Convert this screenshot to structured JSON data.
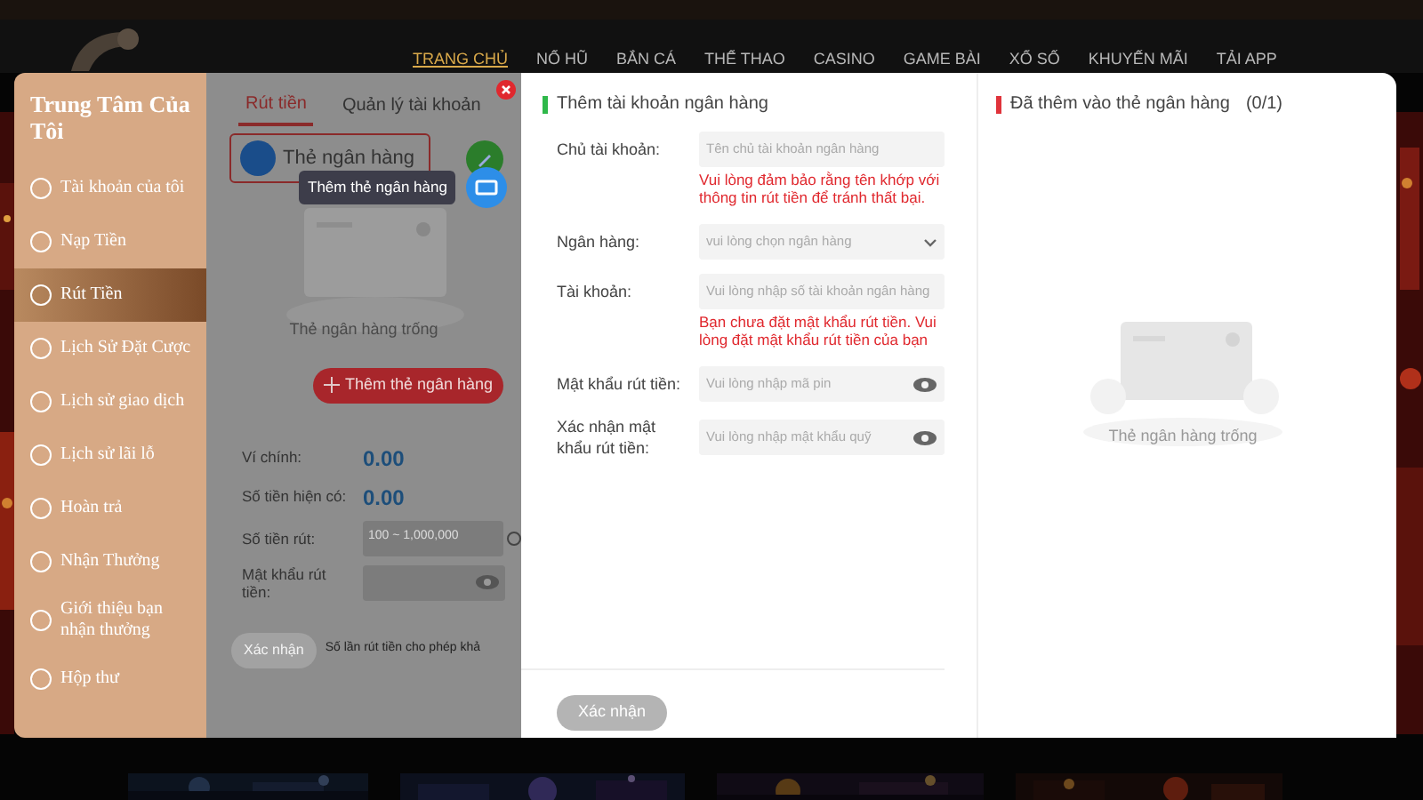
{
  "nav": {
    "items": [
      {
        "label": "TRANG CHỦ",
        "selected": true
      },
      {
        "label": "NỔ HŨ",
        "selected": false
      },
      {
        "label": "BẮN CÁ",
        "selected": false
      },
      {
        "label": "THỂ THAO",
        "selected": false
      },
      {
        "label": "CASINO",
        "selected": false
      },
      {
        "label": "GAME BÀI",
        "selected": false
      },
      {
        "label": "XỔ SỐ",
        "selected": false
      },
      {
        "label": "KHUYẾN MÃI",
        "selected": false
      },
      {
        "label": "TẢI APP",
        "selected": false
      }
    ]
  },
  "sidebar": {
    "title": "Trung Tâm Của Tôi",
    "items": [
      {
        "label": "Tài khoản của tôi",
        "selected": false
      },
      {
        "label": "Nạp Tiền",
        "selected": false
      },
      {
        "label": "Rút Tiền",
        "selected": true
      },
      {
        "label": "Lịch Sử Đặt Cược",
        "selected": false
      },
      {
        "label": "Lịch sử giao dịch",
        "selected": false
      },
      {
        "label": "Lịch sử lãi lỗ",
        "selected": false
      },
      {
        "label": "Hoàn trả",
        "selected": false
      },
      {
        "label": "Nhận Thưởng",
        "selected": false
      },
      {
        "label": "Giới thiệu bạn nhận thưởng",
        "selected": false
      },
      {
        "label": "Hộp thư",
        "selected": false
      }
    ]
  },
  "withdraw": {
    "tabs": [
      {
        "label": "Rút tiền",
        "selected": true
      },
      {
        "label": "Quản lý tài khoản",
        "selected": false
      }
    ],
    "bank_card_button": "Thẻ ngân hàng",
    "tooltip": "Thêm thẻ ngân hàng",
    "empty_text": "Thẻ ngân hàng trống",
    "add_button": "Thêm thẻ ngân hàng",
    "balances": [
      {
        "label": "Ví chính:",
        "value": "0.00"
      },
      {
        "label": "Số tiền hiện có:",
        "value": "0.00"
      }
    ],
    "fields": [
      {
        "kind": "amount",
        "label": "Số tiền rút:",
        "placeholder": "100 ~ 1,000,000"
      },
      {
        "kind": "password",
        "label": "Mật khẩu rút tiền:"
      }
    ],
    "confirm_button": "Xác nhận",
    "note": "Số lần rút tiền cho phép khả"
  },
  "add_account": {
    "title": "Thêm tài khoản ngân hàng",
    "rows": [
      {
        "kind": "text",
        "label": "Chủ tài khoản:",
        "placeholder": "Tên chủ tài khoản ngân hàng"
      },
      {
        "kind": "warning",
        "text": "Vui lòng đảm bảo rằng tên khớp với thông tin rút tiền để tránh thất bại."
      },
      {
        "kind": "select",
        "label": "Ngân hàng:",
        "placeholder": "vui lòng chọn ngân hàng"
      },
      {
        "kind": "text",
        "label": "Tài khoản:",
        "placeholder": "Vui lòng nhập số tài khoản ngân hàng"
      },
      {
        "kind": "warning",
        "text": "Bạn chưa đặt mật khẩu rút tiền. Vui lòng đặt mật khẩu rút tiền của bạn"
      },
      {
        "kind": "password",
        "label": "Mật khẩu rút tiền:",
        "placeholder": "Vui lòng nhập mã pin"
      },
      {
        "kind": "password",
        "label": "Xác nhận mật khẩu rút tiền:",
        "placeholder": "Vui lòng nhập mật khẩu quỹ"
      }
    ],
    "confirm_button": "Xác nhận"
  },
  "added_cards": {
    "title": "Đã thêm vào thẻ ngân hàng",
    "count": "(0/1)",
    "empty_text": "Thẻ ngân hàng trống"
  }
}
